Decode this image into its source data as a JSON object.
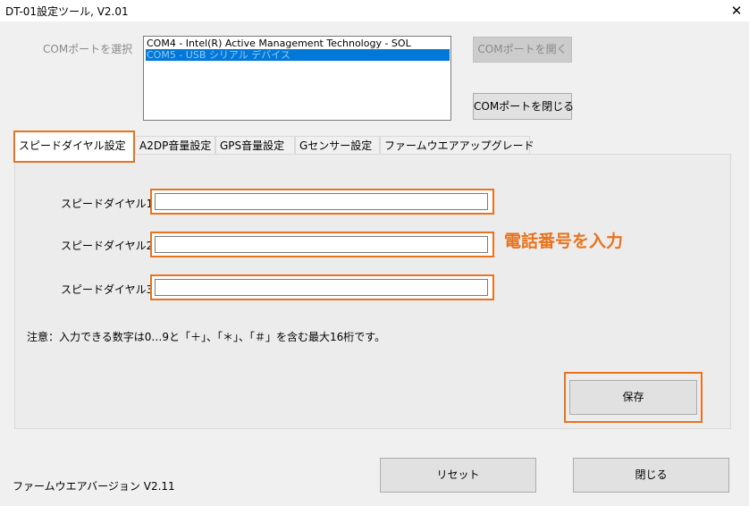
{
  "window": {
    "title": "DT-01設定ツール, V2.01",
    "close_glyph": "✕"
  },
  "com": {
    "label": "COMポートを選択",
    "items": [
      "COM4 - Intel(R) Active Management Technology - SOL",
      "COM5 - USB シリアル デバイス"
    ],
    "selected_index": 1,
    "open_button": "COMポートを開く",
    "close_button": "COMポートを閉じる"
  },
  "tabs": [
    {
      "label": "スピードダイヤル設定",
      "active": true
    },
    {
      "label": "A2DP音量設定"
    },
    {
      "label": "GPS音量設定"
    },
    {
      "label": "Gセンサー設定"
    },
    {
      "label": "ファームウエアアップグレード"
    }
  ],
  "speed_dial": {
    "fields": [
      {
        "label": "スピードダイヤル1",
        "value": ""
      },
      {
        "label": "スピードダイヤル2",
        "value": ""
      },
      {
        "label": "スピードダイヤル3",
        "value": ""
      }
    ],
    "note": "注意：入力できる数字は0…9と「＋」、「＊」、「＃」を含む最大16桁です。",
    "save_button": "保存"
  },
  "annotation": {
    "text": "電話番号を入力",
    "color": "#e8731e"
  },
  "footer": {
    "firmware_version": "ファームウエアバージョン V2.11",
    "reset_button": "リセット",
    "close_button": "閉じる"
  },
  "colors": {
    "accent_outline": "#e8731e",
    "selection": "#0078d7"
  }
}
